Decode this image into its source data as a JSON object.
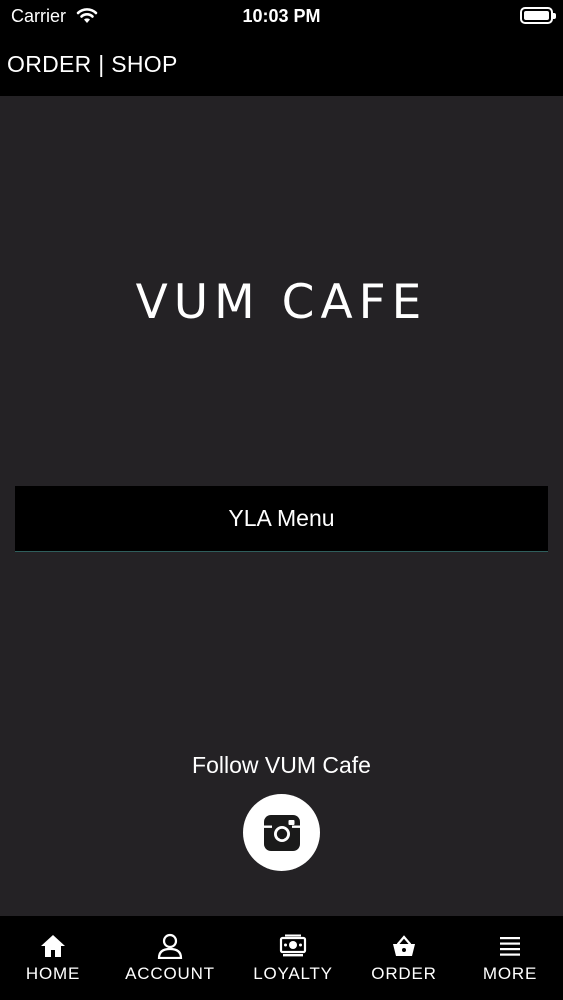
{
  "status_bar": {
    "carrier": "Carrier",
    "time": "10:03 PM"
  },
  "nav": {
    "title": "ORDER | SHOP"
  },
  "logo": {
    "text": "VUM CAFE"
  },
  "main": {
    "menu_button_label": "YLA Menu",
    "follow_label": "Follow VUM Cafe"
  },
  "tabs": [
    {
      "label": "HOME",
      "icon": "home-icon"
    },
    {
      "label": "ACCOUNT",
      "icon": "person-icon"
    },
    {
      "label": "LOYALTY",
      "icon": "money-icon"
    },
    {
      "label": "ORDER",
      "icon": "basket-icon"
    },
    {
      "label": "MORE",
      "icon": "menu-lines-icon"
    }
  ],
  "colors": {
    "background": "#242225",
    "bar": "#000000",
    "text": "#ffffff",
    "button_underline": "#2f5e5c"
  }
}
